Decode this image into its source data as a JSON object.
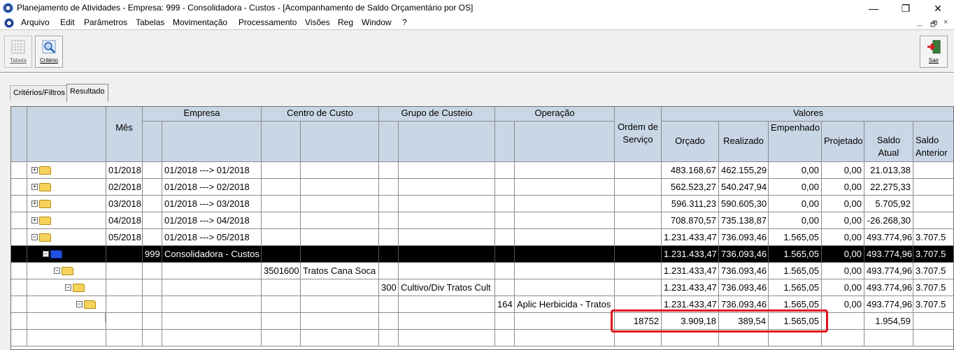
{
  "window": {
    "title": "Planejamento de Atividades  - Empresa: 999 - Consolidadora - Custos - [Acompanhamento de Saldo Orçamentário por OS]",
    "controls": {
      "minimize": "—",
      "restore": "❐",
      "close": "✕"
    }
  },
  "menu": {
    "items": [
      "Arquivo",
      "Edit",
      "Parâmetros",
      "Tabelas",
      "Movimentação",
      "Processamento",
      "Visões",
      "Reg",
      "Window",
      "?"
    ],
    "mdi": {
      "minimize": "_",
      "restore": "🗗",
      "close": "×"
    }
  },
  "toolbar": {
    "tabela_label": "Tabela",
    "criterio_label": "Critério",
    "sair_label": "Sair"
  },
  "tabs": {
    "criterios": "Critérios/Filtros",
    "resultado": "Resultado"
  },
  "grid": {
    "group_headers": {
      "empresa": "Empresa",
      "centro": "Centro de Custo",
      "grupo": "Grupo de Custeio",
      "operacao": "Operação",
      "valores": "Valores"
    },
    "col_headers": {
      "mes": "Mês",
      "os": "Ordem de Serviço",
      "orcado": "Orçado",
      "realizado": "Realizado",
      "empenhado": "Empenhado",
      "projetado": "Projetado",
      "saldo_atual": "Saldo Atual",
      "saldo_ant": "Saldo Anterior"
    },
    "rows": [
      {
        "mes": "01/2018",
        "periodo": "01/2018 ---> 01/2018",
        "orcado": "483.168,67",
        "realizado": "462.155,29",
        "empenhado": "0,00",
        "projetado": "0,00",
        "saldo_atual": "21.013,38",
        "saldo_ant": ""
      },
      {
        "mes": "02/2018",
        "periodo": "01/2018 ---> 02/2018",
        "orcado": "562.523,27",
        "realizado": "540.247,94",
        "empenhado": "0,00",
        "projetado": "0,00",
        "saldo_atual": "22.275,33",
        "saldo_ant": ""
      },
      {
        "mes": "03/2018",
        "periodo": "01/2018 ---> 03/2018",
        "orcado": "596.311,23",
        "realizado": "590.605,30",
        "empenhado": "0,00",
        "projetado": "0,00",
        "saldo_atual": "5.705,92",
        "saldo_ant": ""
      },
      {
        "mes": "04/2018",
        "periodo": "01/2018 ---> 04/2018",
        "orcado": "708.870,57",
        "realizado": "735.138,87",
        "empenhado": "0,00",
        "projetado": "0,00",
        "saldo_atual": "-26.268,30",
        "saldo_ant": ""
      },
      {
        "mes": "05/2018",
        "periodo": "01/2018 ---> 05/2018",
        "orcado": "1.231.433,47",
        "realizado": "736.093,46",
        "empenhado": "1.565,05",
        "projetado": "0,00",
        "saldo_atual": "493.774,96",
        "saldo_ant": "3.707.5"
      }
    ],
    "empresa_row": {
      "code": "999",
      "name": "Consolidadora - Custos",
      "orcado": "1.231.433,47",
      "realizado": "736.093,46",
      "empenhado": "1.565,05",
      "projetado": "0,00",
      "saldo_atual": "493.774,96",
      "saldo_ant": "3.707.5"
    },
    "centro_row": {
      "code": "3501600",
      "name": "Tratos Cana Soca",
      "orcado": "1.231.433,47",
      "realizado": "736.093,46",
      "empenhado": "1.565,05",
      "projetado": "0,00",
      "saldo_atual": "493.774,96",
      "saldo_ant": "3.707.5"
    },
    "grupo_row": {
      "code": "300",
      "name": "Cultivo/Div Tratos Cult",
      "orcado": "1.231.433,47",
      "realizado": "736.093,46",
      "empenhado": "1.565,05",
      "projetado": "0,00",
      "saldo_atual": "493.774,96",
      "saldo_ant": "3.707.5"
    },
    "operacao_row": {
      "code": "164",
      "name": "Aplic Herbicida - Tratos",
      "orcado": "1.231.433,47",
      "realizado": "736.093,46",
      "empenhado": "1.565,05",
      "projetado": "0,00",
      "saldo_atual": "493.774,96",
      "saldo_ant": "3.707.5"
    },
    "os_row": {
      "os": "18752",
      "orcado": "3.909,18",
      "realizado": "389,54",
      "empenhado": "1.565,05",
      "projetado": "",
      "saldo_atual": "1.954,59"
    }
  },
  "colors": {
    "header_bg": "#c9d6e5",
    "selected_row": "#000000",
    "highlight": "#e0151d",
    "folder": "#f6d25a"
  }
}
